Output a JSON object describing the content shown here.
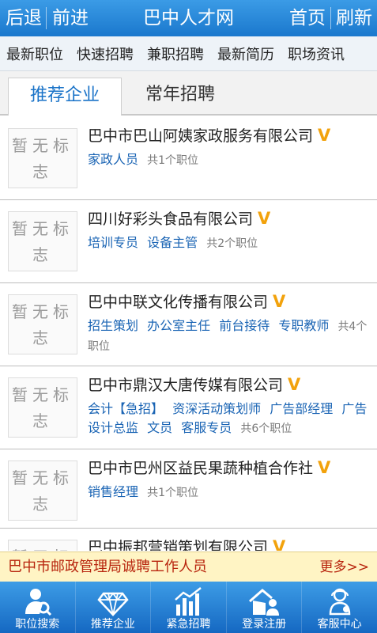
{
  "topbar": {
    "back": "后退",
    "forward": "前进",
    "title": "巴中人才网",
    "home": "首页",
    "refresh": "刷新"
  },
  "categories": [
    "最新职位",
    "快速招聘",
    "兼职招聘",
    "最新简历",
    "职场资讯"
  ],
  "tabs": [
    "推荐企业",
    "常年招聘"
  ],
  "logo_placeholder": "暂无标志",
  "companies": [
    {
      "name": "巴中市巴山阿姨家政服务有限公司",
      "jobs": [
        "家政人员"
      ],
      "count": "共1个职位"
    },
    {
      "name": "四川好彩头食品有限公司",
      "jobs": [
        "培训专员",
        "设备主管"
      ],
      "count": "共2个职位"
    },
    {
      "name": "巴中中联文化传播有限公司",
      "jobs": [
        "招生策划",
        "办公室主任",
        "前台接待",
        "专职教师"
      ],
      "count": "共4个职位"
    },
    {
      "name": "巴中市鼎汉大唐传媒有限公司",
      "jobs": [
        "会计【急招】",
        "资深活动策划师",
        "广告部经理",
        "广告设计总监",
        "文员",
        "客服专员"
      ],
      "count": "共6个职位"
    },
    {
      "name": "巴中市巴州区益民果蔬种植合作社",
      "jobs": [
        "销售经理"
      ],
      "count": "共1个职位"
    },
    {
      "name": "巴中振邦营销策划有限公司",
      "jobs": [],
      "count": ""
    }
  ],
  "notice": {
    "text": "巴中市邮政管理局诚聘工作人员",
    "more": "更多>>"
  },
  "bottom_nav": [
    {
      "label": "职位搜索",
      "icon": "person-search-icon"
    },
    {
      "label": "推荐企业",
      "icon": "diamond-icon"
    },
    {
      "label": "紧急招聘",
      "icon": "bar-chart-icon"
    },
    {
      "label": "登录注册",
      "icon": "house-user-icon"
    },
    {
      "label": "客服中心",
      "icon": "service-icon"
    }
  ],
  "colors": {
    "primary": "#1a78cd",
    "link": "#1a64b4",
    "badge": "#f2a20c",
    "notice_text": "#b8250e",
    "notice_bg": "#fff4c4"
  }
}
